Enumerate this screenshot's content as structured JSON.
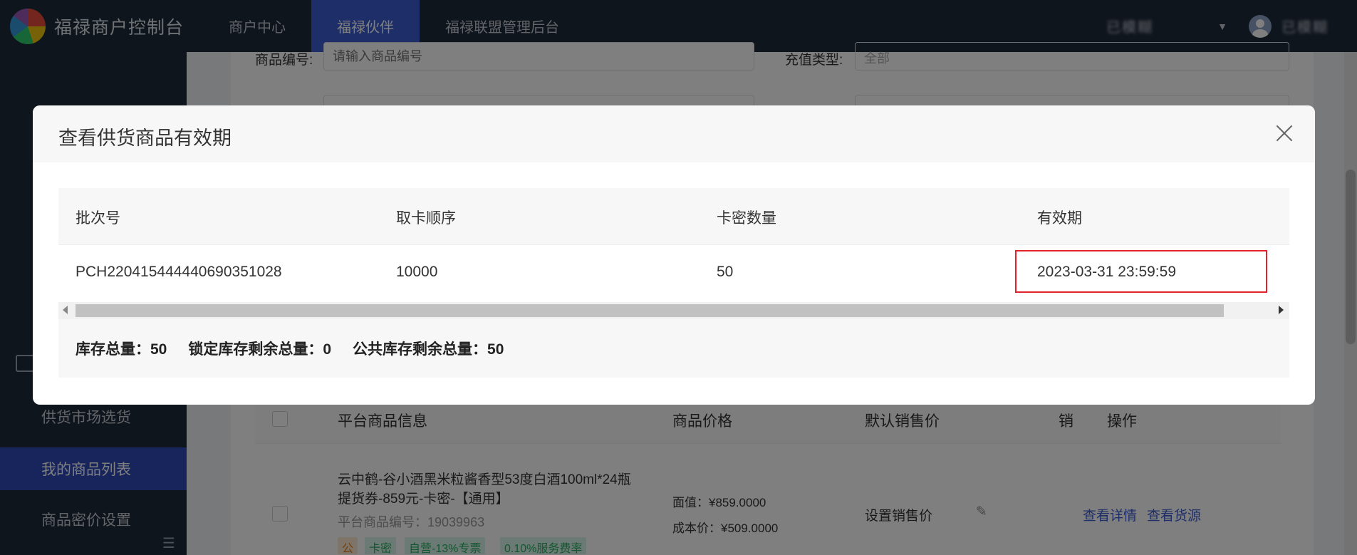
{
  "topbar": {
    "app_title": "福禄商户控制台",
    "tabs": [
      {
        "label": "商户中心"
      },
      {
        "label": "福禄伙伴"
      },
      {
        "label": "福禄联盟管理后台"
      }
    ],
    "active_tab_index": 1,
    "account_name": "已模糊",
    "user_name": "已模糊"
  },
  "sidebar": {
    "items": [
      {
        "label": "供货市场选货"
      },
      {
        "label": "我的商品列表"
      },
      {
        "label": "商品密价设置"
      }
    ],
    "active_item_index": 1
  },
  "background": {
    "filters": {
      "product_code_label": "商品编号:",
      "product_code_placeholder": "请输入商品编号",
      "recharge_type_label": "充值类型:",
      "recharge_type_value": "全部"
    },
    "table_headers": [
      "平台商品信息",
      "商品价格",
      "默认销售价",
      "销",
      "操作"
    ],
    "row": {
      "title_line1": "云中鹤-谷小酒黑米粒酱香型53度白酒100ml*24瓶",
      "title_line2": "提货券-859元-卡密-【通用】",
      "platform_code": "平台商品编号：19039963",
      "face_value": "面值：¥859.0000",
      "cost_price": "成本价：¥509.0000",
      "set_price": "设置销售价",
      "view_detail": "查看详情",
      "view_source": "查看货源",
      "tags": [
        "公",
        "卡密",
        "自营-13%专票",
        "0.10%服务费率"
      ]
    }
  },
  "modal": {
    "title": "查看供货商品有效期",
    "columns": [
      "批次号",
      "取卡顺序",
      "卡密数量",
      "有效期"
    ],
    "rows": [
      {
        "batch": "PCH220415444440690351028",
        "order": "10000",
        "count": "50",
        "expiry": "2023-03-31 23:59:59"
      }
    ],
    "summary": {
      "total_stock": "库存总量：50",
      "locked_remaining": "锁定库存剩余总量：0",
      "public_remaining": "公共库存剩余总量：50"
    }
  },
  "colors": {
    "nav_bg": "#1f2a3b",
    "accent": "#3b5cd0",
    "highlight": "#e5222b"
  }
}
